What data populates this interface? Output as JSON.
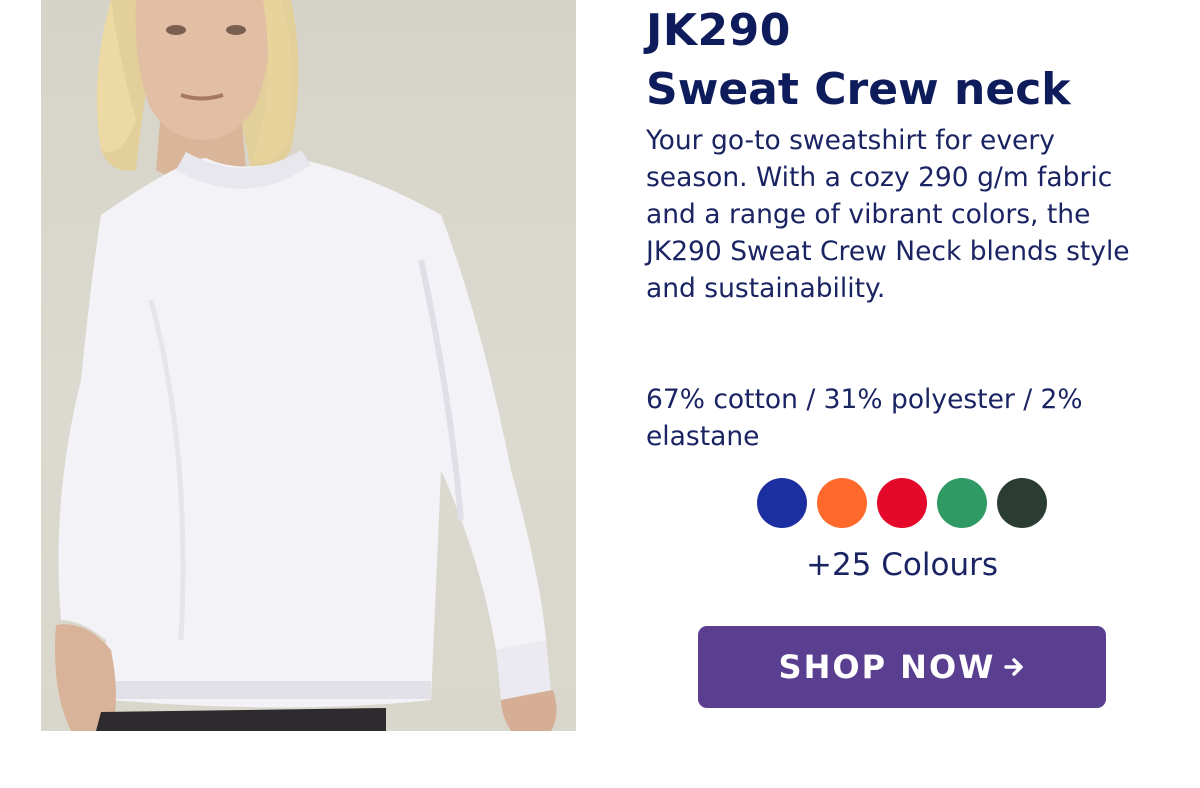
{
  "product": {
    "sku": "JK290",
    "name": "Sweat Crew neck",
    "description": "Your go-to sweatshirt for every season. With a cozy 290 g/m fabric and a range of vibrant colors, the JK290 Sweat Crew Neck blends style and sustainability.",
    "composition": "67% cotton / 31% polyester / 2% elastane",
    "extra_colours": "+25 Colours"
  },
  "swatches": [
    {
      "name": "royal-blue",
      "color": "#1c2fa0"
    },
    {
      "name": "orange",
      "color": "#ff6a2c"
    },
    {
      "name": "red",
      "color": "#e4082b"
    },
    {
      "name": "green",
      "color": "#2f9a64"
    },
    {
      "name": "bottle-green",
      "color": "#2b3c33"
    }
  ],
  "cta": {
    "label": "SHOP NOW",
    "icon": "arrow-right-icon",
    "color": "#5a3f91"
  },
  "colors": {
    "brand_navy": "#0e1c5b",
    "body_text": "#1b2463"
  }
}
